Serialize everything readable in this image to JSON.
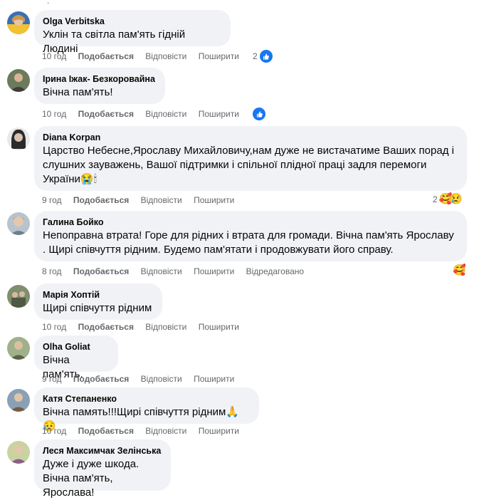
{
  "top_fragment": ".",
  "comments": [
    {
      "name": "Olga Verbitska",
      "text": "Уклін та світла пам'ять гідній Людині",
      "time": "10 год",
      "like": "Подобається",
      "reply": "Відповісти",
      "share": "Поширити",
      "reaction_count": "2",
      "reaction_icons": [
        "like-icon"
      ]
    },
    {
      "name": "Ірина Іжак- Безкоровайна",
      "text": "Вічна пам'ять!",
      "time": "10 год",
      "like": "Подобається",
      "reply": "Відповісти",
      "share": "Поширити",
      "reaction_count": "",
      "reaction_icons": [
        "like-icon"
      ]
    },
    {
      "name": "Diana Korpan",
      "text": "Царство Небесне,Ярославу Михайловичу,нам дуже не вистачатиме Ваших порад і слушних зауважень, Вашої підтримки і спільної плідної праці задля перемоги України😭🕯",
      "time": "9 год",
      "like": "Подобається",
      "reply": "Відповісти",
      "share": "Поширити",
      "reaction_count": "2",
      "reaction_icons": [
        "care-icon",
        "sad-icon"
      ]
    },
    {
      "name": "Галина Бойко",
      "text": "Непоправна втрата! Горе для рідних і втрата для громади. Вічна пам'ять Ярославу . Щирі співчуття рідним. Будемо пам'ятати і продовжувати його справу.",
      "time": "8 год",
      "like": "Подобається",
      "reply": "Відповісти",
      "share": "Поширити",
      "edited": "Відредаговано",
      "reaction_count": "",
      "reaction_icons": [
        "care-icon"
      ]
    },
    {
      "name": "Марія Хоптій",
      "text": "Щирі співчуття рідним",
      "time": "10 год",
      "like": "Подобається",
      "reply": "Відповісти",
      "share": "Поширити"
    },
    {
      "name": "Olha Goliat",
      "text": "Вічна пам'ять.",
      "time": "9 год",
      "like": "Подобається",
      "reply": "Відповісти",
      "share": "Поширити"
    },
    {
      "name": "Катя Степаненко",
      "text": "Вічна память!!!Щирі співчуття рідним🙏😥",
      "time": "10 год",
      "like": "Подобається",
      "reply": "Відповісти",
      "share": "Поширити"
    },
    {
      "name": "Леся Максимчак Зелінська",
      "text": "Дуже і дуже шкода.\nВічна пам'ять, Ярослава!",
      "time": "",
      "like": "",
      "reply": "",
      "share": ""
    }
  ],
  "colors": {
    "bubble": "#f0f2f5",
    "action_text": "#65676b",
    "like_blue": "#1877f2"
  }
}
